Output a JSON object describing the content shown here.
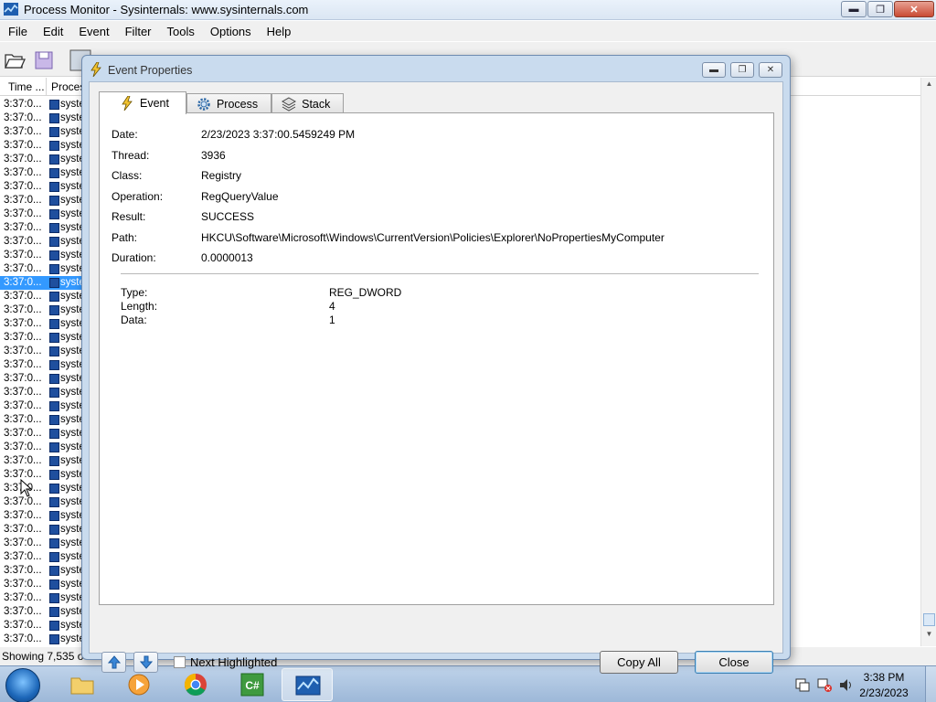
{
  "window": {
    "title": "Process Monitor - Sysinternals: www.sysinternals.com",
    "caption_buttons": {
      "minimize": "▬",
      "restore": "❐",
      "close": "✕"
    }
  },
  "menu": [
    "File",
    "Edit",
    "Event",
    "Filter",
    "Tools",
    "Options",
    "Help"
  ],
  "list": {
    "columns": [
      "Time ...",
      "Proces"
    ],
    "rows": [
      {
        "time": "3:37:0...",
        "process": "syste"
      },
      {
        "time": "3:37:0...",
        "process": "syste"
      },
      {
        "time": "3:37:0...",
        "process": "syste"
      },
      {
        "time": "3:37:0...",
        "process": "syste"
      },
      {
        "time": "3:37:0...",
        "process": "syste"
      },
      {
        "time": "3:37:0...",
        "process": "syste"
      },
      {
        "time": "3:37:0...",
        "process": "syste"
      },
      {
        "time": "3:37:0...",
        "process": "syste"
      },
      {
        "time": "3:37:0...",
        "process": "syste"
      },
      {
        "time": "3:37:0...",
        "process": "syste"
      },
      {
        "time": "3:37:0...",
        "process": "syste"
      },
      {
        "time": "3:37:0...",
        "process": "syste"
      },
      {
        "time": "3:37:0...",
        "process": "syste"
      },
      {
        "time": "3:37:0...",
        "process": "syste",
        "selected": true
      },
      {
        "time": "3:37:0...",
        "process": "syste"
      },
      {
        "time": "3:37:0...",
        "process": "syste"
      },
      {
        "time": "3:37:0...",
        "process": "syste"
      },
      {
        "time": "3:37:0...",
        "process": "syste"
      },
      {
        "time": "3:37:0...",
        "process": "syste"
      },
      {
        "time": "3:37:0...",
        "process": "syste"
      },
      {
        "time": "3:37:0...",
        "process": "syste"
      },
      {
        "time": "3:37:0...",
        "process": "syste"
      },
      {
        "time": "3:37:0...",
        "process": "syste"
      },
      {
        "time": "3:37:0...",
        "process": "syste"
      },
      {
        "time": "3:37:0...",
        "process": "syste"
      },
      {
        "time": "3:37:0...",
        "process": "syste"
      },
      {
        "time": "3:37:0...",
        "process": "syste"
      },
      {
        "time": "3:37:0...",
        "process": "syste"
      },
      {
        "time": "3:37:0...",
        "process": "syste"
      },
      {
        "time": "3:37:0...",
        "process": "syste"
      },
      {
        "time": "3:37:0...",
        "process": "syste"
      },
      {
        "time": "3:37:0...",
        "process": "syste"
      },
      {
        "time": "3:37:0...",
        "process": "syste"
      },
      {
        "time": "3:37:0...",
        "process": "syste"
      },
      {
        "time": "3:37:0...",
        "process": "syste"
      },
      {
        "time": "3:37:0...",
        "process": "syste"
      },
      {
        "time": "3:37:0...",
        "process": "syste"
      },
      {
        "time": "3:37:0...",
        "process": "syste"
      },
      {
        "time": "3:37:0...",
        "process": "syste"
      },
      {
        "time": "3:37:0...",
        "process": "syste"
      }
    ]
  },
  "status": {
    "text": "Showing 7,535 o"
  },
  "dialog": {
    "title": "Event Properties",
    "tabs": [
      {
        "label": "Event",
        "icon": "lightning-icon",
        "active": true
      },
      {
        "label": "Process",
        "icon": "gear-icon"
      },
      {
        "label": "Stack",
        "icon": "stack-icon"
      }
    ],
    "event": {
      "date_label": "Date:",
      "date": "2/23/2023 3:37:00.5459249 PM",
      "thread_label": "Thread:",
      "thread": "3936",
      "class_label": "Class:",
      "class": "Registry",
      "operation_label": "Operation:",
      "operation": "RegQueryValue",
      "result_label": "Result:",
      "result": "SUCCESS",
      "path_label": "Path:",
      "path": "HKCU\\Software\\Microsoft\\Windows\\CurrentVersion\\Policies\\Explorer\\NoPropertiesMyComputer",
      "duration_label": "Duration:",
      "duration": "0.0000013"
    },
    "details": {
      "type_label": "Type:",
      "type": "REG_DWORD",
      "length_label": "Length:",
      "length": "4",
      "data_label": "Data:",
      "data": "1"
    },
    "next_highlighted": "Next Highlighted",
    "copy_all": "Copy All",
    "close": "Close"
  },
  "taskbar": {
    "apps": [
      "explorer-icon",
      "media-player-icon",
      "chrome-icon",
      "csharp-icon",
      "process-monitor-icon"
    ],
    "time": "3:38 PM",
    "date": "2/23/2023"
  }
}
